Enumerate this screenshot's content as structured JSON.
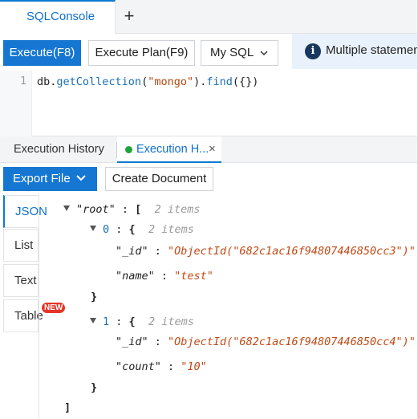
{
  "tabs": {
    "active_label": "SQLConsole",
    "add_label": "+"
  },
  "toolbar": {
    "execute_label": "Execute(F8)",
    "plan_label": "Execute Plan(F9)",
    "mode_label": "My SQL",
    "notice_text": "Multiple statemen"
  },
  "editor": {
    "line_number": "1",
    "code_prefix": "db.",
    "code_fn1": "getCollection",
    "code_open1": "(",
    "code_str": "\"mongo\"",
    "code_mid": ").",
    "code_fn2": "find",
    "code_tail": "({})"
  },
  "result_tabs": {
    "history_label": "Execution History",
    "exec_label": "Execution H...",
    "close_glyph": "×"
  },
  "result_toolbar": {
    "export_label": "Export File",
    "create_label": "Create Document"
  },
  "view_tabs": {
    "json": "JSON",
    "list": "List",
    "text": "Text",
    "table": "Table",
    "new_badge": "NEW"
  },
  "tree": {
    "root_key": "\"root\"",
    "root_open": "[",
    "root_count": "2 items",
    "item0_index": "0",
    "item0_open": "{",
    "item0_count": "2 items",
    "item0_id_key": "\"_id\"",
    "item0_id_val": "\"ObjectId(\"682c1ac16f94807446850cc3\")\"",
    "item0_name_key": "\"name\"",
    "item0_name_val": "\"test\"",
    "item0_close": "}",
    "item1_index": "1",
    "item1_open": "{",
    "item1_count": "2 items",
    "item1_id_key": "\"_id\"",
    "item1_id_val": "\"ObjectId(\"682c1ac16f94807446850cc4\")\"",
    "item1_count_key": "\"count\"",
    "item1_count_val": "\"10\"",
    "item1_close": "}",
    "root_close": "]",
    "colon": " : "
  },
  "colors": {
    "accent": "#1677d2",
    "notice_bg": "#e9f2fc",
    "string": "#c04a16",
    "badge": "#e5352a",
    "status_dot": "#1fa33b"
  },
  "icons": [
    "plus-icon",
    "chevron-down-icon",
    "info-icon",
    "status-dot-icon",
    "close-icon",
    "expand-triangle-icon"
  ]
}
